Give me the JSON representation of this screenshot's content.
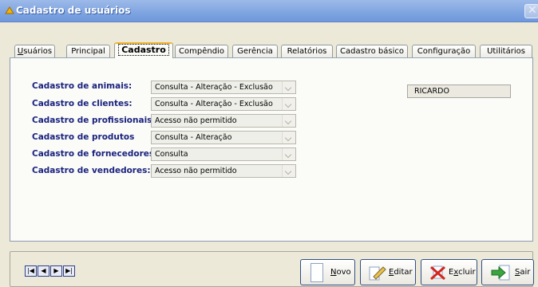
{
  "window": {
    "title": "Cadastro de usuários"
  },
  "tabs": [
    {
      "label": "Usuários",
      "underline": "U",
      "rest": "suários"
    },
    {
      "label": "Principal"
    },
    {
      "label": "Cadastro"
    },
    {
      "label": "Compêndio"
    },
    {
      "label": "Gerência"
    },
    {
      "label": "Relatórios"
    },
    {
      "label": "Cadastro básico"
    },
    {
      "label": "Configuração"
    },
    {
      "label": "Utilitários"
    }
  ],
  "rows": [
    {
      "label": "Cadastro de animais:",
      "value": "Consulta - Alteração  - Exclusão"
    },
    {
      "label": "Cadastro de clientes:",
      "value": "Consulta - Alteração  - Exclusão"
    },
    {
      "label": "Cadastro de profissionais:",
      "value": "Acesso não permitido"
    },
    {
      "label": "Cadastro de produtos",
      "value": "Consulta  - Alteração"
    },
    {
      "label": "Cadastro de fornecedores:",
      "value": "Consulta"
    },
    {
      "label": "Cadastro de vendedores:",
      "value": "Acesso não permitido"
    }
  ],
  "user": {
    "name": "RICARDO"
  },
  "nav": {
    "first": "|◀",
    "prev": "◀",
    "next": "▶",
    "last": "▶|"
  },
  "buttons": {
    "novo": {
      "ul": "N",
      "rest": "ovo"
    },
    "editar": {
      "ul": "E",
      "rest": "ditar"
    },
    "excluir": {
      "pre": "E",
      "ul": "x",
      "rest": "cluir"
    },
    "sair": {
      "ul": "S",
      "rest": "air"
    }
  }
}
